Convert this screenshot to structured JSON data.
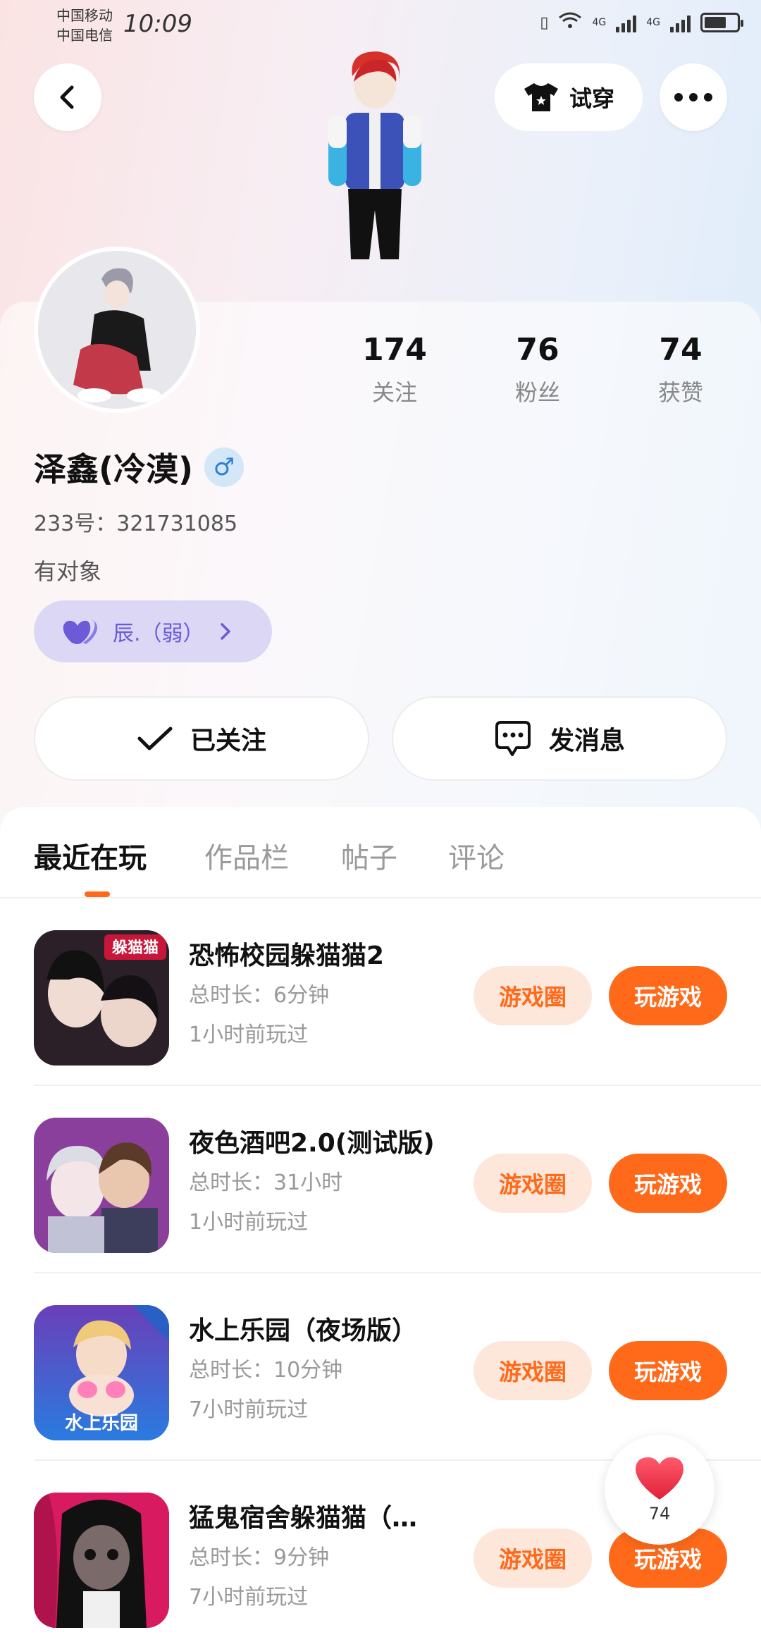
{
  "status_bar": {
    "carrier1": "中国移动",
    "carrier2": "中国电信",
    "time": "10:09",
    "net1": "4G",
    "net2": "4G"
  },
  "header": {
    "tryon_label": "试穿"
  },
  "profile": {
    "stats": [
      {
        "value": "174",
        "label": "关注"
      },
      {
        "value": "76",
        "label": "粉丝"
      },
      {
        "value": "74",
        "label": "获赞"
      }
    ],
    "username": "泽鑫(冷漠)",
    "gender_symbol": "♂",
    "uid": "233号：321731085",
    "bio": "有对象",
    "cp_name": "辰.（弱）"
  },
  "actions": {
    "follow_label": "已关注",
    "message_label": "发消息"
  },
  "tabs": [
    {
      "label": "最近在玩"
    },
    {
      "label": "作品栏"
    },
    {
      "label": "帖子"
    },
    {
      "label": "评论"
    }
  ],
  "games": [
    {
      "title": "恐怖校园躲猫猫2",
      "duration": "总时长：6分钟",
      "last_played": "1小时前玩过",
      "icon_text": "躲猫猫",
      "icon_color": "#3a2a35"
    },
    {
      "title": "夜色酒吧2.0(测试版)",
      "duration": "总时长：31小时",
      "last_played": "1小时前玩过",
      "icon_text": "",
      "icon_color": "#7a3f8f"
    },
    {
      "title": "水上乐园（夜场版）",
      "duration": "总时长：10分钟",
      "last_played": "7小时前玩过",
      "icon_text": "水上乐园",
      "icon_color": "#3b6fd8"
    },
    {
      "title": "猛鬼宿舍躲猫猫（…",
      "duration": "总时长：9分钟",
      "last_played": "7小时前玩过",
      "icon_text": "",
      "icon_color": "#c2185b"
    }
  ],
  "game_buttons": {
    "circle_label": "游戏圈",
    "play_label": "玩游戏"
  },
  "like_float": {
    "count": "74"
  },
  "colors": {
    "accent": "#ff6a1a",
    "accent_light": "#fde6da",
    "cp_purple": "#6b5bd6"
  }
}
